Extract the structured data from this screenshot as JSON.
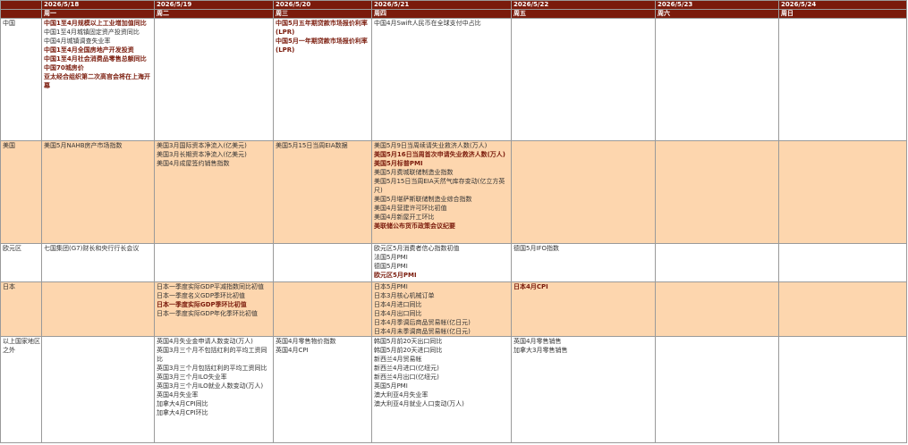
{
  "dates": [
    "",
    "2026/5/18",
    "2026/5/19",
    "2026/5/20",
    "2026/5/21",
    "2026/5/22",
    "2026/5/23",
    "2026/5/24"
  ],
  "weekdays": [
    "",
    "周一",
    "周二",
    "周三",
    "周四",
    "周五",
    "周六",
    "周日"
  ],
  "rows": [
    {
      "region": "中国",
      "cells": [
        [
          {
            "t": "中国1至4月规模以上工业增加值同比",
            "b": true
          },
          {
            "t": "中国1至4月城镇固定资产投资同比",
            "b": false
          },
          {
            "t": "中国4月城镇调查失业率",
            "b": false
          },
          {
            "t": "中国1至4月全国房地产开发投资",
            "b": true
          },
          {
            "t": "中国1至4月社会消费品零售总额同比",
            "b": true
          },
          {
            "t": "中国70城房价",
            "b": true
          },
          {
            "t": "亚太经合组织第二次高官会将在上海开幕",
            "b": true
          }
        ],
        [],
        [
          {
            "t": "中国5月五年期贷款市场报价利率(LPR)",
            "b": true
          },
          {
            "t": "中国5月一年期贷款市场报价利率(LPR)",
            "b": true
          }
        ],
        [
          {
            "t": "中国4月Swift人民币在全球支付中占比",
            "b": false
          }
        ],
        [],
        [],
        []
      ]
    },
    {
      "region": "美国",
      "cells": [
        [
          {
            "t": "美国5月NAHB房产市场指数",
            "b": false
          }
        ],
        [
          {
            "t": "美国3月国际资本净流入(亿美元)",
            "b": false
          },
          {
            "t": "美国3月长期资本净流入(亿美元)",
            "b": false
          },
          {
            "t": "美国4月成屋签约销售指数",
            "b": false
          }
        ],
        [
          {
            "t": "美国5月15日当周EIA数据",
            "b": false
          }
        ],
        [
          {
            "t": "美国5月9日当周续请失业救济人数(万人)",
            "b": false
          },
          {
            "t": "美国5月16日当周首次申请失业救济人数(万人)",
            "b": true
          },
          {
            "t": "美国5月标普PMI",
            "b": true
          },
          {
            "t": "美国5月费城联储制造业指数",
            "b": false
          },
          {
            "t": "美国5月15日当周EIA天然气库存变动(亿立方英尺)",
            "b": false
          },
          {
            "t": "美国5月堪萨斯联储制造业综合指数",
            "b": false
          },
          {
            "t": "美国4月营建许可环比初值",
            "b": false
          },
          {
            "t": "美国4月新屋开工环比",
            "b": false
          },
          {
            "t": "美联储公布货币政策会议纪要",
            "b": true
          }
        ],
        [],
        [],
        []
      ]
    },
    {
      "region": "欧元区",
      "cells": [
        [
          {
            "t": "七国集团(G7)财长和央行行长会议",
            "b": false
          }
        ],
        [],
        [],
        [
          {
            "t": "欧元区5月消费者信心指数初值",
            "b": false
          },
          {
            "t": "法国5月PMI",
            "b": false
          },
          {
            "t": "德国5月PMI",
            "b": false
          },
          {
            "t": "欧元区5月PMI",
            "b": true
          }
        ],
        [
          {
            "t": "德国5月IFO指数",
            "b": false
          }
        ],
        [],
        []
      ]
    },
    {
      "region": "日本",
      "cells": [
        [],
        [
          {
            "t": "日本一季度实际GDP平减指数同比初值",
            "b": false
          },
          {
            "t": "日本一季度名义GDP季环比初值",
            "b": false
          },
          {
            "t": "日本一季度实际GDP季环比初值",
            "b": true
          },
          {
            "t": "日本一季度实际GDP年化季环比初值",
            "b": false
          }
        ],
        [],
        [
          {
            "t": "日本5月PMI",
            "b": false
          },
          {
            "t": "日本3月核心机械订单",
            "b": false
          },
          {
            "t": "日本4月进口同比",
            "b": false
          },
          {
            "t": "日本4月出口同比",
            "b": false
          },
          {
            "t": "日本4月季调后商品贸易帐(亿日元)",
            "b": false
          },
          {
            "t": "日本4月未季调商品贸易帐(亿日元)",
            "b": false
          }
        ],
        [
          {
            "t": "日本4月CPI",
            "b": true
          }
        ],
        [],
        []
      ]
    },
    {
      "region": "以上国家地区之外",
      "cells": [
        [],
        [
          {
            "t": "英国4月失业金申请人数变动(万人)",
            "b": false
          },
          {
            "t": "英国3月三个月不包括红利的平均工资同比",
            "b": false
          },
          {
            "t": "英国3月三个月包括红利的平均工资同比",
            "b": false
          },
          {
            "t": "英国3月三个月ILO失业率",
            "b": false
          },
          {
            "t": "英国3月三个月ILO就业人数变动(万人)",
            "b": false
          },
          {
            "t": "英国4月失业率",
            "b": false
          },
          {
            "t": "加拿大4月CPI同比",
            "b": false
          },
          {
            "t": "加拿大4月CPI环比",
            "b": false
          }
        ],
        [
          {
            "t": "英国4月零售物价指数",
            "b": false
          },
          {
            "t": "英国4月CPI",
            "b": false
          }
        ],
        [
          {
            "t": "韩国5月前20天出口同比",
            "b": false
          },
          {
            "t": "韩国5月前20天进口同比",
            "b": false
          },
          {
            "t": "新西兰4月贸易帐",
            "b": false
          },
          {
            "t": "新西兰4月进口(亿纽元)",
            "b": false
          },
          {
            "t": "新西兰4月出口(亿纽元)",
            "b": false
          },
          {
            "t": "英国5月PMI",
            "b": false
          },
          {
            "t": "澳大利亚4月失业率",
            "b": false
          },
          {
            "t": "澳大利亚4月就业人口变动(万人)",
            "b": false
          }
        ],
        [
          {
            "t": "英国4月零售销售",
            "b": false
          },
          {
            "t": "加拿大3月零售销售",
            "b": false
          }
        ],
        [],
        []
      ]
    }
  ]
}
